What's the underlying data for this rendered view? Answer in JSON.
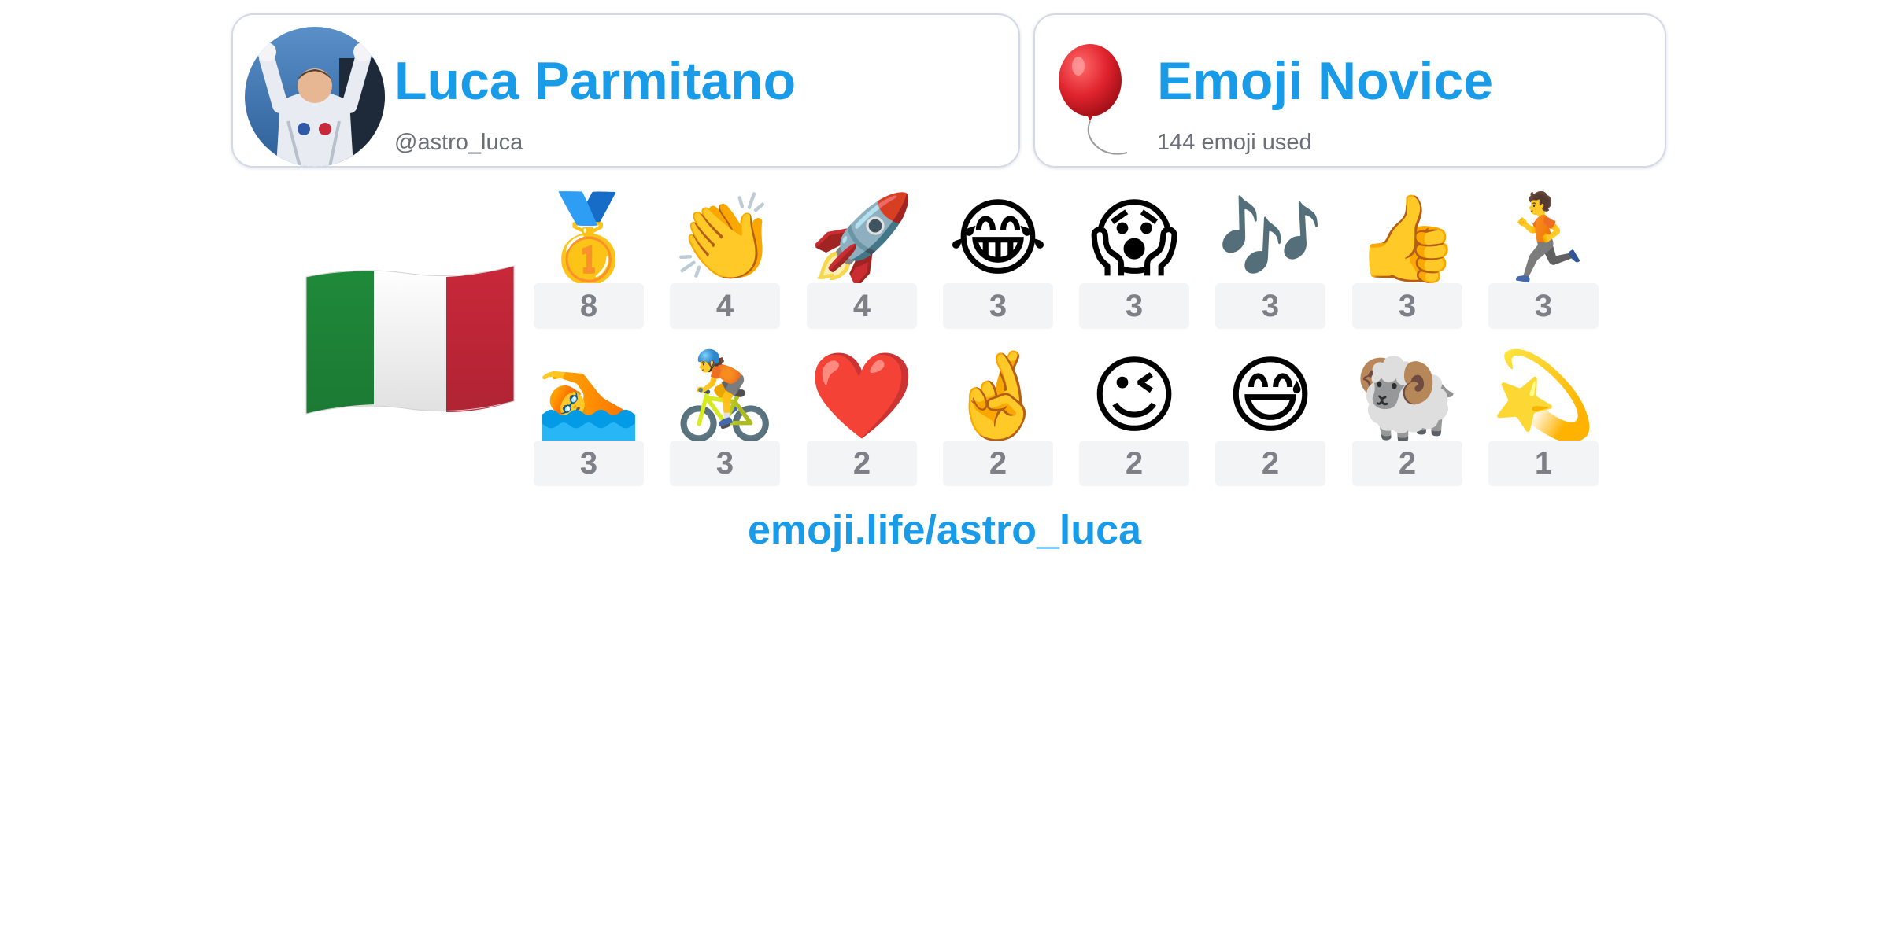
{
  "profile": {
    "name": "Luca Parmitano",
    "handle": "@astro_luca"
  },
  "badge": {
    "title": "Emoji Novice",
    "subtitle": "144 emoji used",
    "icon": "balloon-icon"
  },
  "country_flag": {
    "icon": "italy-flag-icon",
    "colors": [
      "#1f8a3a",
      "#ffffff",
      "#c8283a"
    ]
  },
  "emoji_stats": [
    {
      "emoji": "🥇",
      "count": "8"
    },
    {
      "emoji": "👏",
      "count": "4"
    },
    {
      "emoji": "🚀",
      "count": "4"
    },
    {
      "emoji": "😂",
      "count": "3"
    },
    {
      "emoji": "😱",
      "count": "3"
    },
    {
      "emoji": "🎶",
      "count": "3"
    },
    {
      "emoji": "👍",
      "count": "3"
    },
    {
      "emoji": "🏃",
      "count": "3"
    },
    {
      "emoji": "🏊",
      "count": "3"
    },
    {
      "emoji": "🚴",
      "count": "3"
    },
    {
      "emoji": "❤️",
      "count": "2"
    },
    {
      "emoji": "🤞",
      "count": "2"
    },
    {
      "emoji": "😉",
      "count": "2"
    },
    {
      "emoji": "😅",
      "count": "2"
    },
    {
      "emoji": "🐏",
      "count": "2"
    },
    {
      "emoji": "💫",
      "count": "1"
    }
  ],
  "footer": {
    "link": "emoji.life/astro_luca"
  },
  "colors": {
    "accent": "#1a9be8",
    "muted_text": "#6b6f78",
    "count_bg": "#f3f4f6"
  }
}
